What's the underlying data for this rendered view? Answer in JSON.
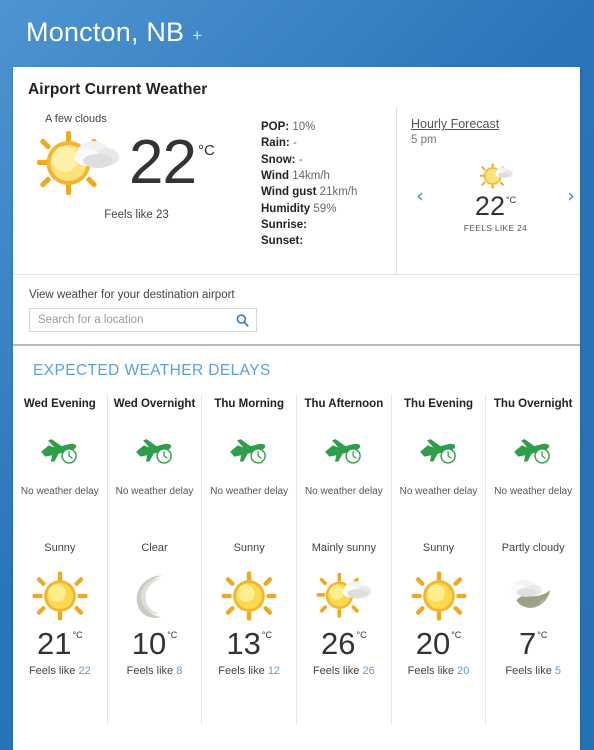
{
  "header": {
    "city": "Moncton, NB",
    "add_label": "+"
  },
  "card": {
    "title": "Airport Current Weather"
  },
  "current": {
    "condition": "A few clouds",
    "icon": "sun-cloud-icon",
    "temperature": "22",
    "unit": "°C",
    "feels_like": "Feels like 23",
    "details": [
      {
        "key": "POP:",
        "value": "10%"
      },
      {
        "key": "Rain:",
        "value": "-"
      },
      {
        "key": "Snow:",
        "value": "-"
      },
      {
        "key": "Wind",
        "value": "14km/h"
      },
      {
        "key": "Wind gust",
        "value": "21km/h"
      },
      {
        "key": "Humidity",
        "value": "59%"
      },
      {
        "key": "Sunrise:",
        "value": ""
      },
      {
        "key": "Sunset:",
        "value": ""
      }
    ]
  },
  "hourly": {
    "link_label": "Hourly Forecast",
    "time": "5 pm",
    "prev_arrow": "‹",
    "next_arrow": "›",
    "icon": "sun-cloud-icon",
    "temperature": "22",
    "unit": "°C",
    "feels_like": "FEELS LIKE 24"
  },
  "search": {
    "caption": "View weather for your destination airport",
    "placeholder": "Search for a location",
    "value": ""
  },
  "delays": {
    "title": "EXPECTED WEATHER DELAYS",
    "columns": [
      {
        "period": "Wed Evening",
        "delay_icon": "plane-clock-icon",
        "delay_text": "No weather delay",
        "condition": "Sunny",
        "icon": "sun-icon",
        "temperature": "21",
        "unit": "°C",
        "feels_prefix": "Feels like ",
        "feels_value": "22"
      },
      {
        "period": "Wed Overnight",
        "delay_icon": "plane-clock-icon",
        "delay_text": "No weather delay",
        "condition": "Clear",
        "icon": "moon-icon",
        "temperature": "10",
        "unit": "°C",
        "feels_prefix": "Feels like ",
        "feels_value": "8"
      },
      {
        "period": "Thu Morning",
        "delay_icon": "plane-clock-icon",
        "delay_text": "No weather delay",
        "condition": "Sunny",
        "icon": "sun-icon",
        "temperature": "13",
        "unit": "°C",
        "feels_prefix": "Feels like ",
        "feels_value": "12"
      },
      {
        "period": "Thu Afternoon",
        "delay_icon": "plane-clock-icon",
        "delay_text": "No weather delay",
        "condition": "Mainly sunny",
        "icon": "sun-cloud-icon",
        "temperature": "26",
        "unit": "°C",
        "feels_prefix": "Feels like ",
        "feels_value": "26"
      },
      {
        "period": "Thu Evening",
        "delay_icon": "plane-clock-icon",
        "delay_text": "No weather delay",
        "condition": "Sunny",
        "icon": "sun-icon",
        "temperature": "20",
        "unit": "°C",
        "feels_prefix": "Feels like ",
        "feels_value": "20"
      },
      {
        "period": "Thu Overnight",
        "delay_icon": "plane-clock-icon",
        "delay_text": "No weather delay",
        "condition": "Partly cloudy",
        "icon": "moon-cloud-icon",
        "temperature": "7",
        "unit": "°C",
        "feels_prefix": "Feels like ",
        "feels_value": "5"
      }
    ]
  },
  "colors": {
    "background_blue": "#2a75b9",
    "accent_blue": "#5ba0d8",
    "delay_green": "#2e9e4a",
    "sun_yellow": "#f5c518"
  }
}
